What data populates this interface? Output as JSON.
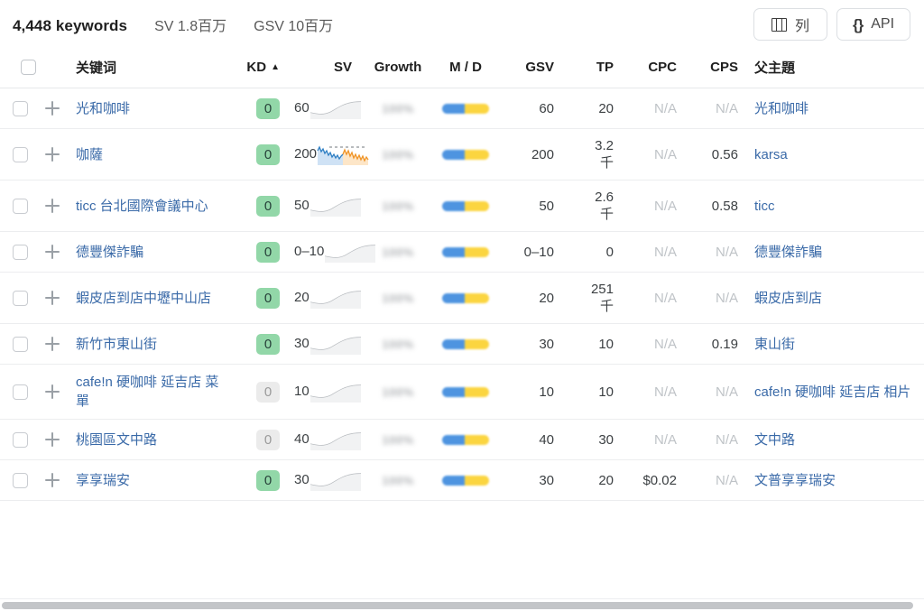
{
  "topbar": {
    "keyword_count": "4,448 keywords",
    "sv_summary": "SV 1.8百万",
    "gsv_summary": "GSV 10百万",
    "columns_button": "列",
    "api_button": "API",
    "columns_icon": "columns-icon",
    "api_icon": "braces-icon"
  },
  "table": {
    "headers": {
      "keyword": "关键词",
      "kd": "KD",
      "kd_sort": "▲",
      "sv": "SV",
      "growth": "Growth",
      "md": "M / D",
      "gsv": "GSV",
      "tp": "TP",
      "cpc": "CPC",
      "cps": "CPS",
      "parent_topic": "父主題"
    },
    "growth_masked_label": "100%",
    "rows": [
      {
        "keyword": "光和咖啡",
        "kd": "0",
        "kd_style": "green",
        "sv": "60",
        "growth": "100%",
        "gsv": "60",
        "tp": "20",
        "tp_unit": "",
        "cpc": "N/A",
        "cpc_na": true,
        "cps": "N/A",
        "cps_na": true,
        "parent_topic": "光和咖啡",
        "spark": "flat"
      },
      {
        "keyword": "咖薩",
        "kd": "0",
        "kd_style": "green",
        "sv": "200",
        "growth": "100%",
        "gsv": "200",
        "tp": "3.2",
        "tp_unit": "千",
        "cpc": "N/A",
        "cpc_na": true,
        "cps": "0.56",
        "cps_na": false,
        "parent_topic": "karsa",
        "spark": "volatile"
      },
      {
        "keyword": "ticc 台北國際會議中心",
        "kd": "0",
        "kd_style": "green",
        "sv": "50",
        "growth": "100%",
        "gsv": "50",
        "tp": "2.6",
        "tp_unit": "千",
        "cpc": "N/A",
        "cpc_na": true,
        "cps": "0.58",
        "cps_na": false,
        "parent_topic": "ticc",
        "spark": "flat"
      },
      {
        "keyword": "德豐傑詐騙",
        "kd": "0",
        "kd_style": "green",
        "sv": "0–10",
        "growth": "100%",
        "gsv": "0–10",
        "tp": "0",
        "tp_unit": "",
        "cpc": "N/A",
        "cpc_na": true,
        "cps": "N/A",
        "cps_na": true,
        "parent_topic": "德豐傑詐騙",
        "spark": "flat"
      },
      {
        "keyword": "蝦皮店到店中壢中山店",
        "kd": "0",
        "kd_style": "green",
        "sv": "20",
        "growth": "100%",
        "gsv": "20",
        "tp": "251",
        "tp_unit": "千",
        "cpc": "N/A",
        "cpc_na": true,
        "cps": "N/A",
        "cps_na": true,
        "parent_topic": "蝦皮店到店",
        "spark": "flat"
      },
      {
        "keyword": "新竹市東山街",
        "kd": "0",
        "kd_style": "green",
        "sv": "30",
        "growth": "100%",
        "gsv": "30",
        "tp": "10",
        "tp_unit": "",
        "cpc": "N/A",
        "cpc_na": true,
        "cps": "0.19",
        "cps_na": false,
        "parent_topic": "東山街",
        "spark": "flat"
      },
      {
        "keyword": "cafe!n 硬咖啡 延吉店 菜單",
        "kd": "0",
        "kd_style": "gray",
        "sv": "10",
        "growth": "100%",
        "gsv": "10",
        "tp": "10",
        "tp_unit": "",
        "cpc": "N/A",
        "cpc_na": true,
        "cps": "N/A",
        "cps_na": true,
        "parent_topic": "cafe!n 硬咖啡 延吉店 相片",
        "spark": "flat"
      },
      {
        "keyword": "桃園區文中路",
        "kd": "0",
        "kd_style": "gray",
        "sv": "40",
        "growth": "100%",
        "gsv": "40",
        "tp": "30",
        "tp_unit": "",
        "cpc": "N/A",
        "cpc_na": true,
        "cps": "N/A",
        "cps_na": true,
        "parent_topic": "文中路",
        "spark": "flat"
      },
      {
        "keyword": "享享瑞安",
        "kd": "0",
        "kd_style": "green",
        "sv": "30",
        "growth": "100%",
        "gsv": "30",
        "tp": "20",
        "tp_unit": "",
        "cpc": "$0.02",
        "cpc_na": false,
        "cps": "N/A",
        "cps_na": true,
        "parent_topic": "文普享享瑞安",
        "spark": "flat"
      }
    ]
  },
  "colors": {
    "kd_green_bg": "#92d7a8",
    "kd_gray_bg": "#ebebeb",
    "link": "#3a6aa8",
    "md_blue": "#4e94e0",
    "md_yellow": "#fbd540",
    "spark_blue": "#2e7fc4",
    "spark_orange": "#f09426"
  }
}
